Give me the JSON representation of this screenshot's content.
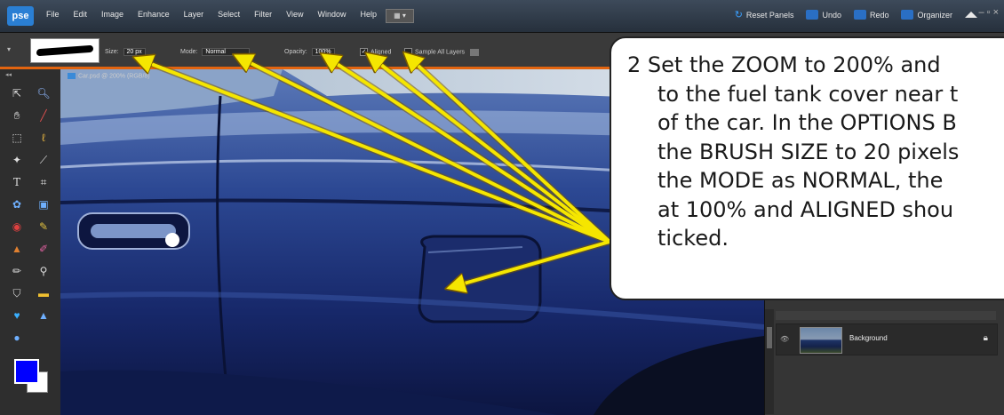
{
  "app": {
    "logo": "pse",
    "menu": [
      "File",
      "Edit",
      "Image",
      "Enhance",
      "Layer",
      "Select",
      "Filter",
      "View",
      "Window",
      "Help"
    ],
    "right_buttons": [
      {
        "label": "Reset Panels",
        "icon": "reset-icon"
      },
      {
        "label": "Undo",
        "icon": "undo-icon"
      },
      {
        "label": "Redo",
        "icon": "redo-icon"
      },
      {
        "label": "Organizer",
        "icon": "organizer-icon"
      }
    ],
    "window_controls": "– ▫ ×"
  },
  "options_bar": {
    "size_label": "Size:",
    "size_value": "20 px",
    "mode_label": "Mode:",
    "mode_value": "Normal",
    "opacity_label": "Opacity:",
    "opacity_value": "100%",
    "aligned_label": "Aligned",
    "aligned_checked": true,
    "sample_all_layers_label": "Sample All Layers",
    "sample_all_layers_checked": false
  },
  "document": {
    "tab_title": "Car.psd @ 200% (RGB/8)"
  },
  "toolbox": {
    "foreground_color": "#0000ff",
    "background_color": "#ffffff",
    "tools": [
      "move-tool",
      "zoom-tool",
      "hand-tool",
      "eyedropper-tool",
      "marquee-tool",
      "lasso-tool",
      "magic-wand-tool",
      "selection-brush-tool",
      "type-tool",
      "crop-tool",
      "cookie-cutter-tool",
      "straighten-tool",
      "red-eye-tool",
      "healing-brush-tool",
      "clone-stamp-tool",
      "eraser-tool",
      "brush-tool",
      "smart-brush-tool",
      "paint-bucket-tool",
      "gradient-tool",
      "custom-shape-tool",
      "blur-tool",
      "sponge-tool"
    ]
  },
  "layers_panel": {
    "layer_name": "Background",
    "locked": true
  },
  "callout": {
    "lines": [
      "2  Set the ZOOM to 200% and",
      "to the fuel tank cover near t",
      "of the car.  In the OPTIONS B",
      "the BRUSH SIZE to 20 pixels",
      "the MODE as NORMAL, the",
      "at 100% and ALIGNED shou",
      "ticked."
    ]
  },
  "colors": {
    "accent": "#e2640f",
    "arrow": "#f5e600",
    "car_body": "#1d2f6e"
  }
}
